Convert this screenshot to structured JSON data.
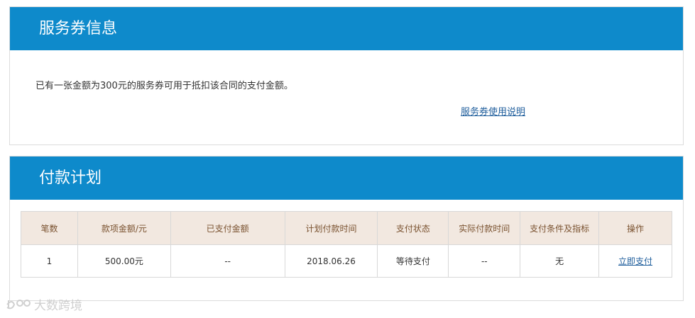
{
  "voucher": {
    "title": "服务券信息",
    "message": "已有一张金额为300元的服务券可用于抵扣该合同的支付金额。",
    "help_link": "服务券使用说明"
  },
  "plan": {
    "title": "付款计划",
    "columns": [
      "笔数",
      "款项金额/元",
      "已支付金额",
      "计划付款时间",
      "支付状态",
      "实际付款时间",
      "支付条件及指标",
      "操作"
    ],
    "rows": [
      {
        "index": "1",
        "amount": "500.00元",
        "paid": "--",
        "planned_date": "2018.06.26",
        "status": "等待支付",
        "actual_date": "--",
        "condition": "无",
        "action": "立即支付"
      }
    ]
  },
  "watermark": {
    "text": "大数跨境",
    "icon": "brand-logo-icon"
  },
  "colors": {
    "header_bg": "#0e8acb",
    "table_header_bg": "#f2e8e0",
    "table_header_text": "#7a5230",
    "link": "#1f5e9c"
  }
}
